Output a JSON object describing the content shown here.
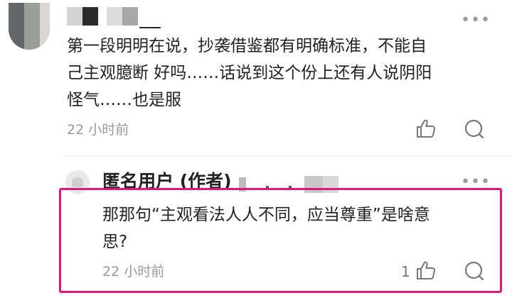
{
  "colors": {
    "highlight": "#e0187e",
    "text": "#222222",
    "muted": "#999999",
    "icon": "#777777"
  },
  "comment": {
    "text_lines": [
      "第一段明明在说，抄袭借鉴都有明确标准，不能自",
      "己主观臆断 好吗……话说到这个份上还有人说阴阳",
      "怪气……也是服"
    ],
    "time": "22 小时前",
    "icons": {
      "more": "more-dots-icon",
      "like": "thumbs-up-icon",
      "reply": "comment-bubble-icon"
    }
  },
  "reply": {
    "author": "匿名用户 (作者)",
    "text_lines": [
      "那那句“主观看法人人不同，应当尊重”是啥意",
      "思?"
    ],
    "time": "22 小时前",
    "like_count": "1",
    "icons": {
      "more": "more-dots-icon",
      "like": "thumbs-up-icon",
      "reply": "comment-bubble-icon"
    }
  }
}
